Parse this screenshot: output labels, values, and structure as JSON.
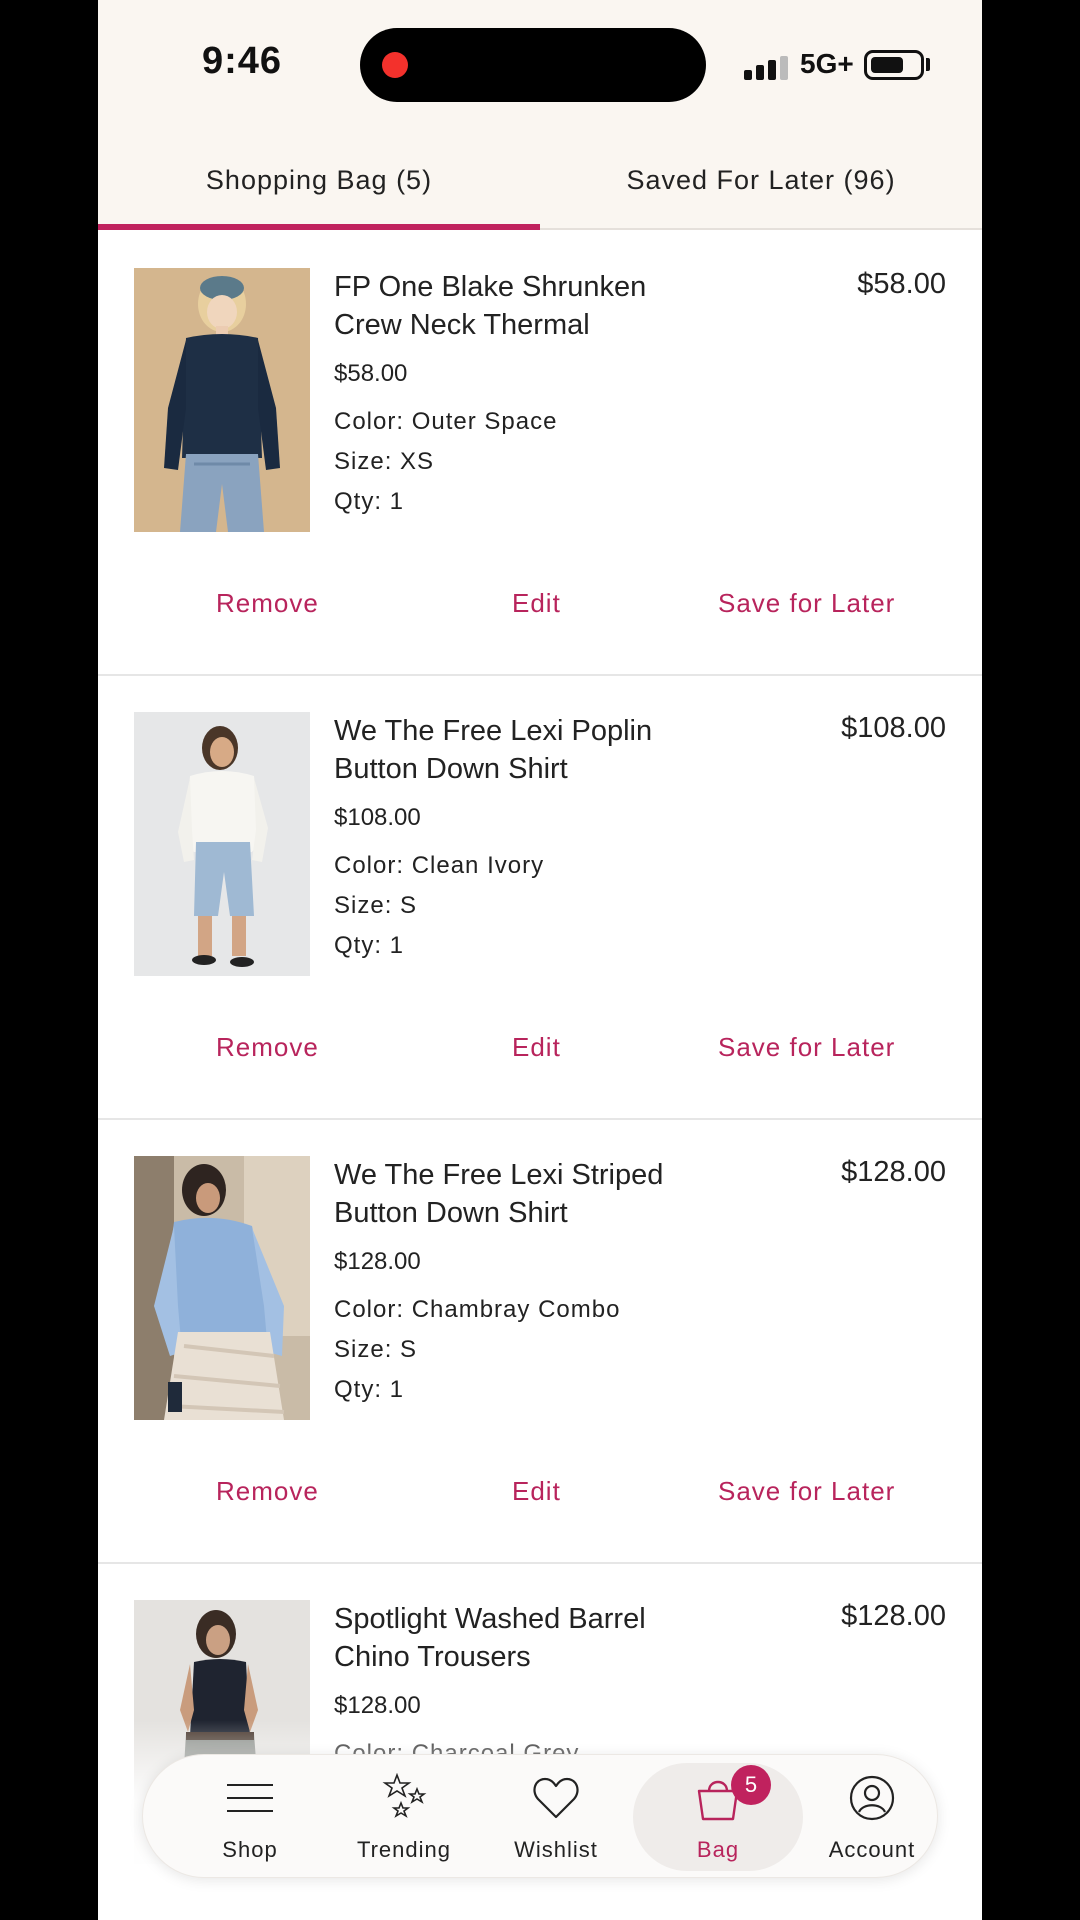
{
  "status_bar": {
    "time": "9:46",
    "network": "5G+"
  },
  "tabs": [
    {
      "label": "Shopping Bag (5)",
      "active": true
    },
    {
      "label": "Saved For Later (96)",
      "active": false
    }
  ],
  "accent_color": "#c0225e",
  "items": [
    {
      "name": "FP One Blake Shrunken Crew Neck Thermal",
      "line_price": "$58.00",
      "unit_price": "$58.00",
      "color": "Color: Outer Space",
      "size": "Size: XS",
      "qty": "Qty: 1",
      "actions": {
        "remove": "Remove",
        "edit": "Edit",
        "save": "Save for Later"
      }
    },
    {
      "name": "We The Free Lexi Poplin Button Down Shirt",
      "line_price": "$108.00",
      "unit_price": "$108.00",
      "color": "Color: Clean Ivory",
      "size": "Size: S",
      "qty": "Qty: 1",
      "actions": {
        "remove": "Remove",
        "edit": "Edit",
        "save": "Save for Later"
      }
    },
    {
      "name": "We The Free Lexi Striped Button Down Shirt",
      "line_price": "$128.00",
      "unit_price": "$128.00",
      "color": "Color: Chambray Combo",
      "size": "Size: S",
      "qty": "Qty: 1",
      "actions": {
        "remove": "Remove",
        "edit": "Edit",
        "save": "Save for Later"
      }
    },
    {
      "name": "Spotlight Washed Barrel Chino Trousers",
      "line_price": "$128.00",
      "unit_price": "$128.00",
      "color": "Color: Charcoal Grey",
      "size": "",
      "qty": "",
      "actions": {
        "remove": "",
        "edit": "",
        "save": ""
      }
    }
  ],
  "bottom_nav": {
    "shop": {
      "label": "Shop",
      "icon": "menu-lines-icon"
    },
    "trending": {
      "label": "Trending",
      "icon": "stars-icon"
    },
    "wishlist": {
      "label": "Wishlist",
      "icon": "heart-icon"
    },
    "bag": {
      "label": "Bag",
      "icon": "bag-icon",
      "badge": "5",
      "active": true
    },
    "account": {
      "label": "Account",
      "icon": "account-icon"
    }
  }
}
